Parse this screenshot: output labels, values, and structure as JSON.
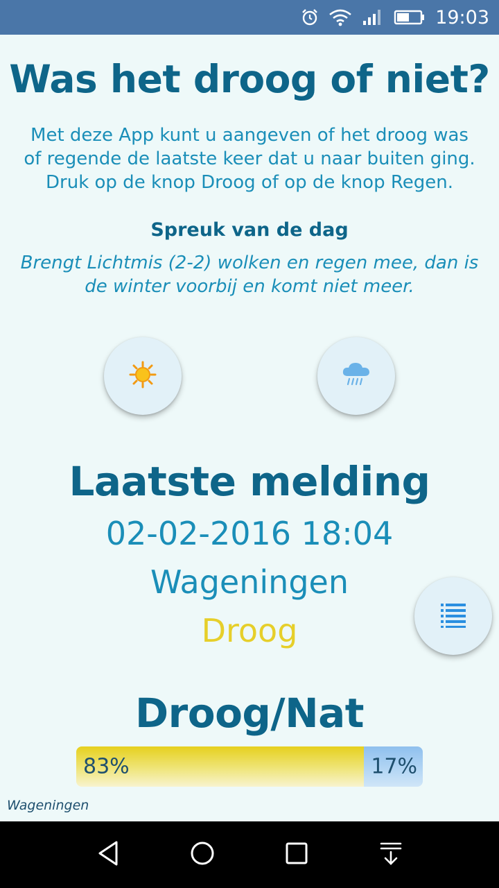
{
  "status_bar": {
    "time": "19:03",
    "icons": [
      "alarm-icon",
      "wifi-icon",
      "signal-icon",
      "battery-icon"
    ]
  },
  "header": {
    "title": "Was het droog of niet?",
    "intro_lines": [
      "Met deze App kunt u aangeven of het droog was",
      "of regende de laatste keer dat u naar buiten ging.",
      "Druk op de knop Droog of op de knop Regen."
    ]
  },
  "quote": {
    "title": "Spreuk van de dag",
    "lines": [
      "Brengt Lichtmis (2-2) wolken en regen mee, dan is",
      "de winter voorbij en komt niet meer."
    ]
  },
  "actions": {
    "dry_icon": "sun-icon",
    "rain_icon": "rain-cloud-icon",
    "list_icon": "list-icon"
  },
  "last_report": {
    "heading": "Laatste melding",
    "datetime": "02-02-2016 18:04",
    "place": "Wageningen",
    "status": "Droog"
  },
  "ratio": {
    "heading": "Droog/Nat",
    "dry_percent": 83,
    "wet_percent": 17,
    "dry_label": "83%",
    "wet_label": "17%"
  },
  "footer": {
    "place": "Wageningen"
  },
  "colors": {
    "title": "#0e6589",
    "text": "#1a8eb8",
    "dry": "#e6cf2a",
    "wet": "#a6cdf2",
    "status_bar": "#4a76a8",
    "background": "#eef9f9"
  },
  "nav_bar": {
    "icons": [
      "back-icon",
      "home-icon",
      "recent-apps-icon",
      "notification-pull-icon"
    ]
  }
}
